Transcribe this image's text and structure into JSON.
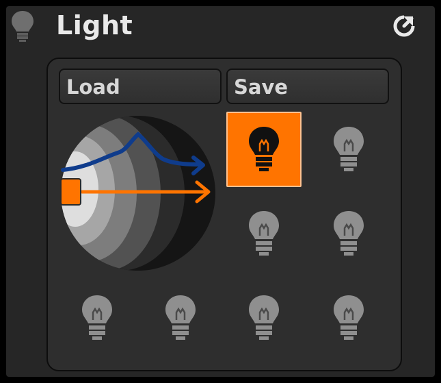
{
  "panel": {
    "title": "Light",
    "header_icon": "lightbulb-icon",
    "reset_icon": "reset-icon"
  },
  "buttons": {
    "load_label": "Load",
    "save_label": "Save"
  },
  "lights": [
    {
      "icon": "lightbulb-icon",
      "active": true
    },
    {
      "icon": "lightbulb-icon",
      "active": false
    },
    {
      "icon": "lightbulb-icon",
      "active": false
    },
    {
      "icon": "lightbulb-icon",
      "active": false
    },
    {
      "icon": "lightbulb-icon",
      "active": false
    },
    {
      "icon": "lightbulb-icon",
      "active": false
    },
    {
      "icon": "lightbulb-icon",
      "active": false
    },
    {
      "icon": "lightbulb-icon",
      "active": false
    }
  ],
  "colors": {
    "active": "#ff7400",
    "inactive_bulb": "#8f8f8f",
    "arrow_orange": "#ff7400",
    "arrow_blue": "#0f3c8c"
  }
}
